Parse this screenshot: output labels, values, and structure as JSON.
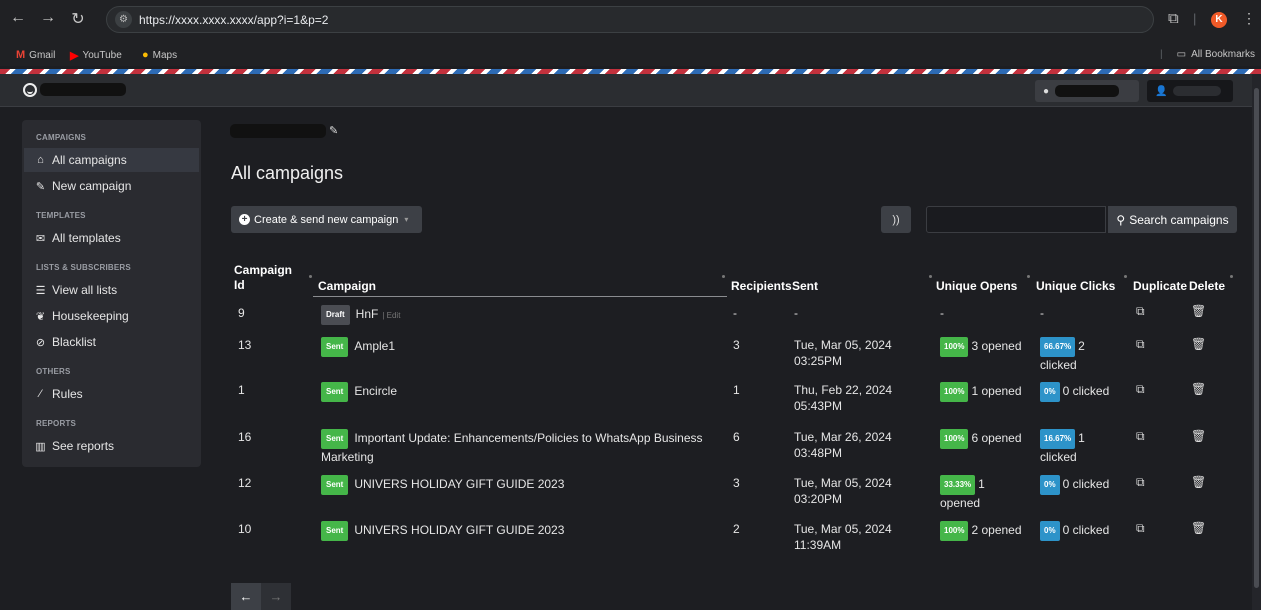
{
  "browser": {
    "url": "https://xxxx.xxxx.xxxx/app?i=1&p=2",
    "profile_initial": "K",
    "bookmarks": [
      "Gmail",
      "YouTube",
      "Maps"
    ],
    "all_bookmarks": "All Bookmarks"
  },
  "sidebar": {
    "sections": [
      {
        "heading": "CAMPAIGNS",
        "items": [
          {
            "label": "All campaigns",
            "icon": "home-icon",
            "active": true
          },
          {
            "label": "New campaign",
            "icon": "edit-icon"
          }
        ]
      },
      {
        "heading": "TEMPLATES",
        "items": [
          {
            "label": "All templates",
            "icon": "envelope-icon"
          }
        ]
      },
      {
        "heading": "LISTS & SUBSCRIBERS",
        "items": [
          {
            "label": "View all lists",
            "icon": "list-icon"
          },
          {
            "label": "Housekeeping",
            "icon": "leaf-icon"
          },
          {
            "label": "Blacklist",
            "icon": "ban-icon"
          }
        ]
      },
      {
        "heading": "OTHERS",
        "items": [
          {
            "label": "Rules",
            "icon": "wand-icon"
          }
        ]
      },
      {
        "heading": "REPORTS",
        "items": [
          {
            "label": "See reports",
            "icon": "bar-chart-icon"
          }
        ]
      }
    ]
  },
  "main": {
    "page_title": "All campaigns",
    "create_button": "Create & send new campaign",
    "search_placeholder": "",
    "search_button": "Search campaigns"
  },
  "table": {
    "headers": {
      "id_line1": "Campaign",
      "id_line2": "Id",
      "campaign": "Campaign",
      "recipients": "Recipients",
      "sent": "Sent",
      "opens": "Unique Opens",
      "clicks": "Unique Clicks",
      "duplicate": "Duplicate",
      "delete": "Delete"
    },
    "rows": [
      {
        "id": "9",
        "status": "Draft",
        "name": "HnF",
        "edit": "| Edit",
        "recipients": "-",
        "sent_date": "-",
        "sent_time": "",
        "open_pct": "",
        "open_text": "-",
        "click_pct": "",
        "click_text": "-"
      },
      {
        "id": "13",
        "status": "Sent",
        "name": "Ample1",
        "recipients": "3",
        "sent_date": "Tue, Mar 05, 2024",
        "sent_time": "03:25PM",
        "open_pct": "100%",
        "open_text": "3 opened",
        "click_pct": "66.67%",
        "click_text": "2 clicked"
      },
      {
        "id": "1",
        "status": "Sent",
        "name": "Encircle",
        "recipients": "1",
        "sent_date": "Thu, Feb 22, 2024",
        "sent_time": "05:43PM",
        "open_pct": "100%",
        "open_text": "1 opened",
        "click_pct": "0%",
        "click_text": "0 clicked"
      },
      {
        "id": "16",
        "status": "Sent",
        "name": "Important Update: Enhancements/Policies to WhatsApp Business",
        "name_line2": "Marketing",
        "recipients": "6",
        "sent_date": "Tue, Mar 26, 2024",
        "sent_time": "03:48PM",
        "open_pct": "100%",
        "open_text": "6 opened",
        "click_pct": "16.67%",
        "click_text": "1 clicked"
      },
      {
        "id": "12",
        "status": "Sent",
        "name": "UNIVERS HOLIDAY GIFT GUIDE 2023",
        "recipients": "3",
        "sent_date": "Tue, Mar 05, 2024",
        "sent_time": "03:20PM",
        "open_pct": "33.33%",
        "open_text": "1 opened",
        "click_pct": "0%",
        "click_text": "0 clicked"
      },
      {
        "id": "10",
        "status": "Sent",
        "name": "UNIVERS HOLIDAY GIFT GUIDE 2023",
        "recipients": "2",
        "sent_date": "Tue, Mar 05, 2024",
        "sent_time": "11:39AM",
        "open_pct": "100%",
        "open_text": "2 opened",
        "click_pct": "0%",
        "click_text": "0 clicked"
      }
    ]
  },
  "colors": {
    "sent_badge": "#45b649",
    "open_pill": "#45b649",
    "click_pill": "#2d93c9",
    "background": "#1d1e22"
  }
}
